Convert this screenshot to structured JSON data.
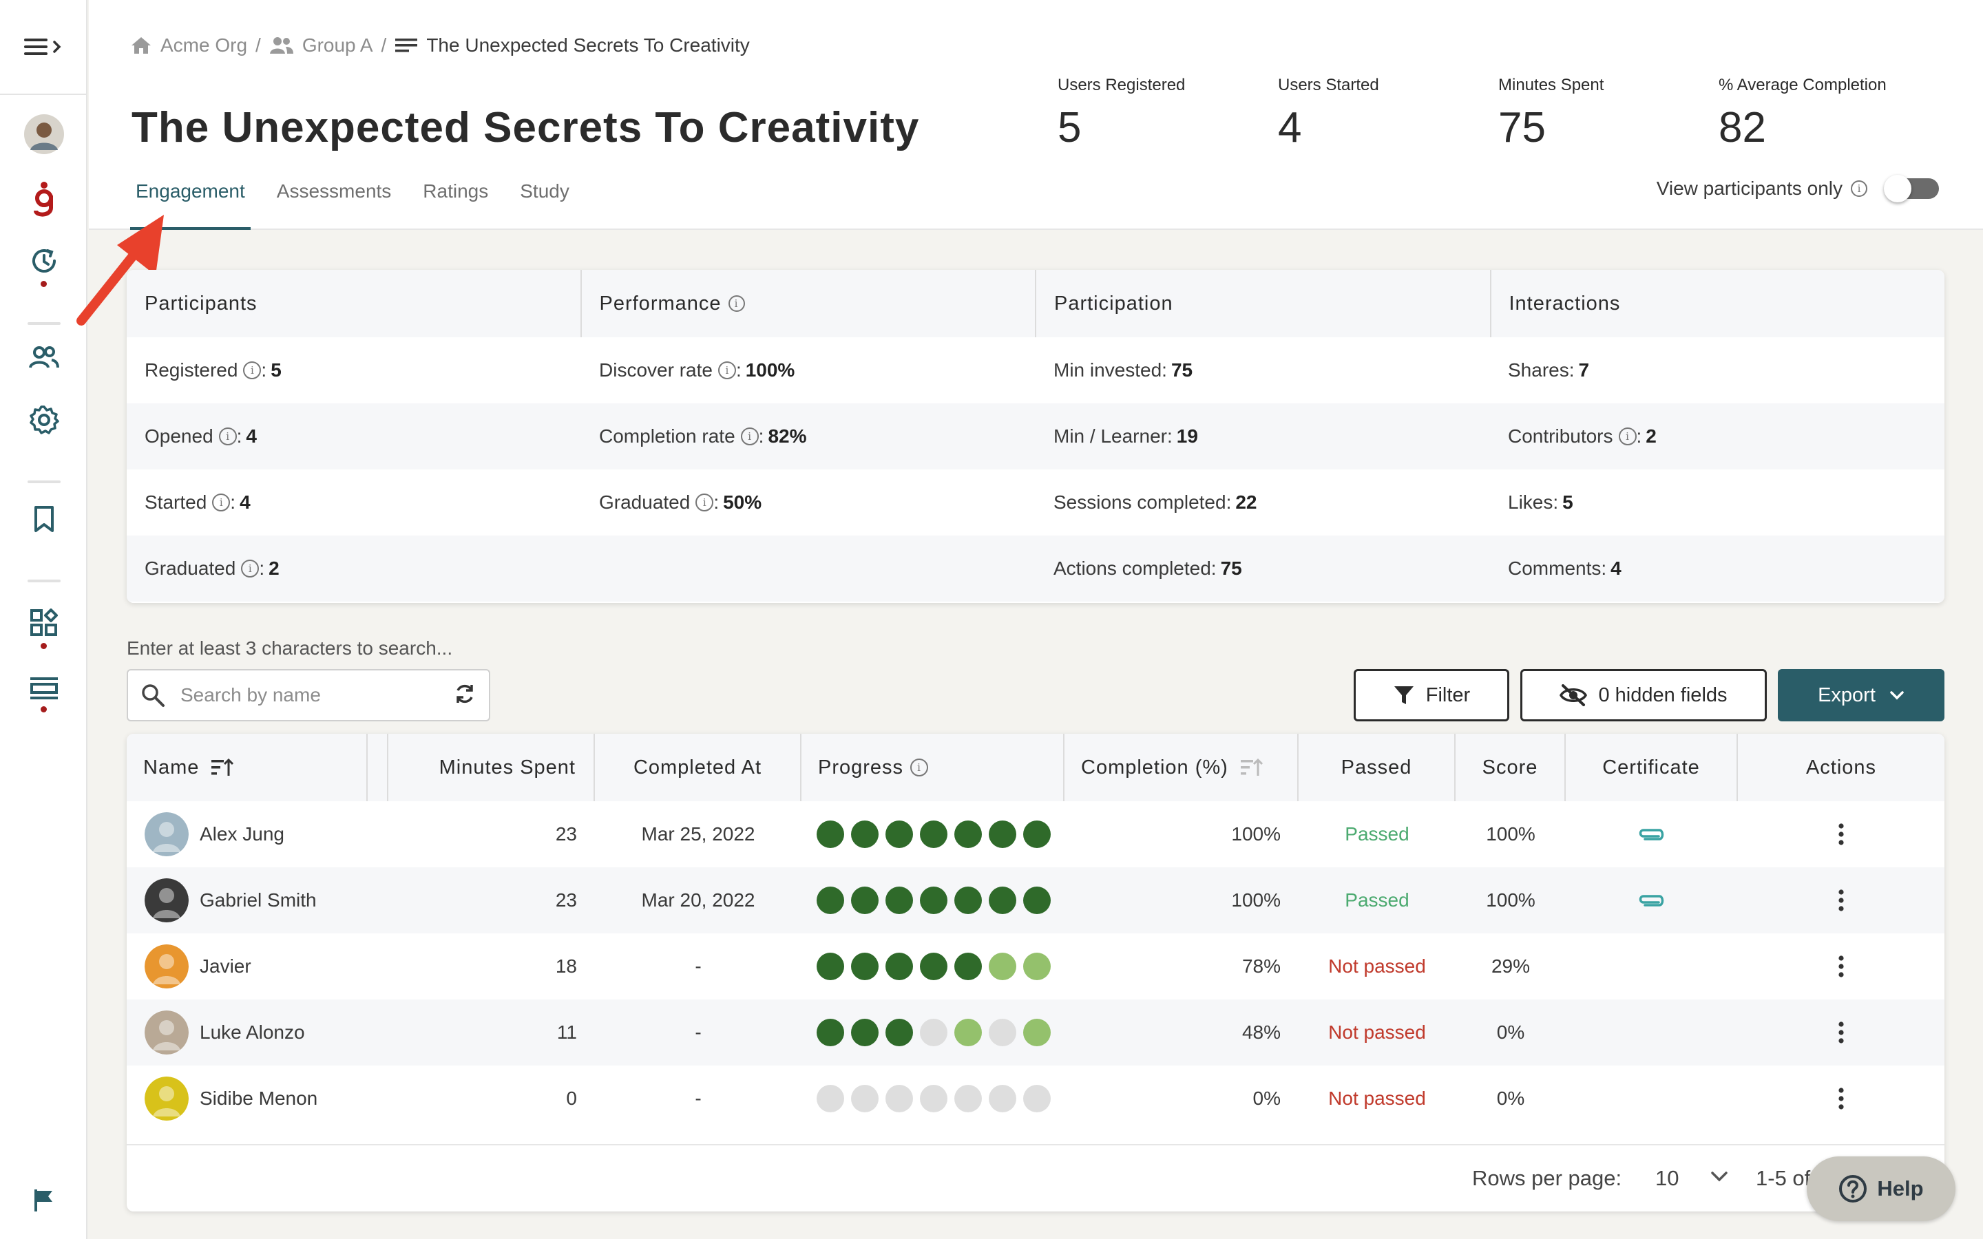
{
  "breadcrumb": {
    "org": "Acme Org",
    "group": "Group A",
    "current": "The Unexpected Secrets To Creativity",
    "separator": "/"
  },
  "page": {
    "title": "The Unexpected Secrets To Creativity"
  },
  "stats": [
    {
      "label": "Users Registered",
      "value": "5"
    },
    {
      "label": "Users Started",
      "value": "4"
    },
    {
      "label": "Minutes Spent",
      "value": "75"
    },
    {
      "label": "% Average Completion",
      "value": "82"
    }
  ],
  "tabs": [
    {
      "label": "Engagement",
      "active": true
    },
    {
      "label": "Assessments",
      "active": false
    },
    {
      "label": "Ratings",
      "active": false
    },
    {
      "label": "Study",
      "active": false
    }
  ],
  "participants_toggle": {
    "label": "View participants only",
    "on": false
  },
  "summary": {
    "headers": [
      "Participants",
      "Performance",
      "Participation",
      "Interactions"
    ],
    "participants": [
      {
        "label": "Registered",
        "value": "5"
      },
      {
        "label": "Opened",
        "value": "4"
      },
      {
        "label": "Started",
        "value": "4"
      },
      {
        "label": "Graduated",
        "value": "2"
      }
    ],
    "performance": [
      {
        "label": "Discover rate",
        "value": "100%"
      },
      {
        "label": "Completion rate",
        "value": "82%"
      },
      {
        "label": "Graduated",
        "value": "50%"
      }
    ],
    "participation": [
      {
        "label": "Min invested:",
        "value": "75"
      },
      {
        "label": "Min / Learner:",
        "value": "19"
      },
      {
        "label": "Sessions completed:",
        "value": "22"
      },
      {
        "label": "Actions completed:",
        "value": "75"
      }
    ],
    "interactions": [
      {
        "label": "Shares:",
        "value": "7"
      },
      {
        "label": "Contributors",
        "value": "2"
      },
      {
        "label": "Likes:",
        "value": "5"
      },
      {
        "label": "Comments:",
        "value": "4"
      }
    ]
  },
  "search": {
    "hint": "Enter at least 3 characters to search...",
    "placeholder": "Search by name",
    "value": ""
  },
  "toolbar": {
    "filter_label": "Filter",
    "hidden_fields_label": "0 hidden fields",
    "export_label": "Export"
  },
  "table": {
    "columns": [
      "Name",
      "Minutes Spent",
      "Completed At",
      "Progress",
      "Completion (%)",
      "Passed",
      "Score",
      "Certificate",
      "Actions"
    ],
    "rows": [
      {
        "name": "Alex Jung",
        "minutes": "23",
        "completed_at": "Mar 25, 2022",
        "progress": [
          "done",
          "done",
          "done",
          "done",
          "done",
          "done",
          "done"
        ],
        "completion": "100%",
        "passed": "Passed",
        "passed_ok": true,
        "score": "100%",
        "certificate": true,
        "avatar_color": "#9fb6c4"
      },
      {
        "name": "Gabriel Smith",
        "minutes": "23",
        "completed_at": "Mar 20, 2022",
        "progress": [
          "done",
          "done",
          "done",
          "done",
          "done",
          "done",
          "done"
        ],
        "completion": "100%",
        "passed": "Passed",
        "passed_ok": true,
        "score": "100%",
        "certificate": true,
        "avatar_color": "#3a3a3a"
      },
      {
        "name": "Javier",
        "minutes": "18",
        "completed_at": "-",
        "progress": [
          "done",
          "done",
          "done",
          "done",
          "done",
          "partial",
          "partial"
        ],
        "completion": "78%",
        "passed": "Not passed",
        "passed_ok": false,
        "score": "29%",
        "certificate": false,
        "avatar_color": "#e8962f"
      },
      {
        "name": "Luke Alonzo",
        "minutes": "11",
        "completed_at": "-",
        "progress": [
          "done",
          "done",
          "done",
          "none",
          "partial",
          "none",
          "partial"
        ],
        "completion": "48%",
        "passed": "Not passed",
        "passed_ok": false,
        "score": "0%",
        "certificate": false,
        "avatar_color": "#b9a996"
      },
      {
        "name": "Sidibe Menon",
        "minutes": "0",
        "completed_at": "-",
        "progress": [
          "none",
          "none",
          "none",
          "none",
          "none",
          "none",
          "none"
        ],
        "completion": "0%",
        "passed": "Not passed",
        "passed_ok": false,
        "score": "0%",
        "certificate": false,
        "avatar_color": "#d8c21a"
      }
    ]
  },
  "pagination": {
    "rows_per_page_label": "Rows per page:",
    "rows_per_page": "10",
    "range": "1-5 of"
  },
  "help": {
    "label": "Help"
  },
  "colors": {
    "accent": "#2a5d68",
    "progress_done": "#2f6a2a",
    "progress_partial": "#94c16c",
    "progress_none": "#dedede",
    "passed": "#4caa70",
    "not_passed": "#c0392b",
    "annotation": "#e8412c"
  }
}
